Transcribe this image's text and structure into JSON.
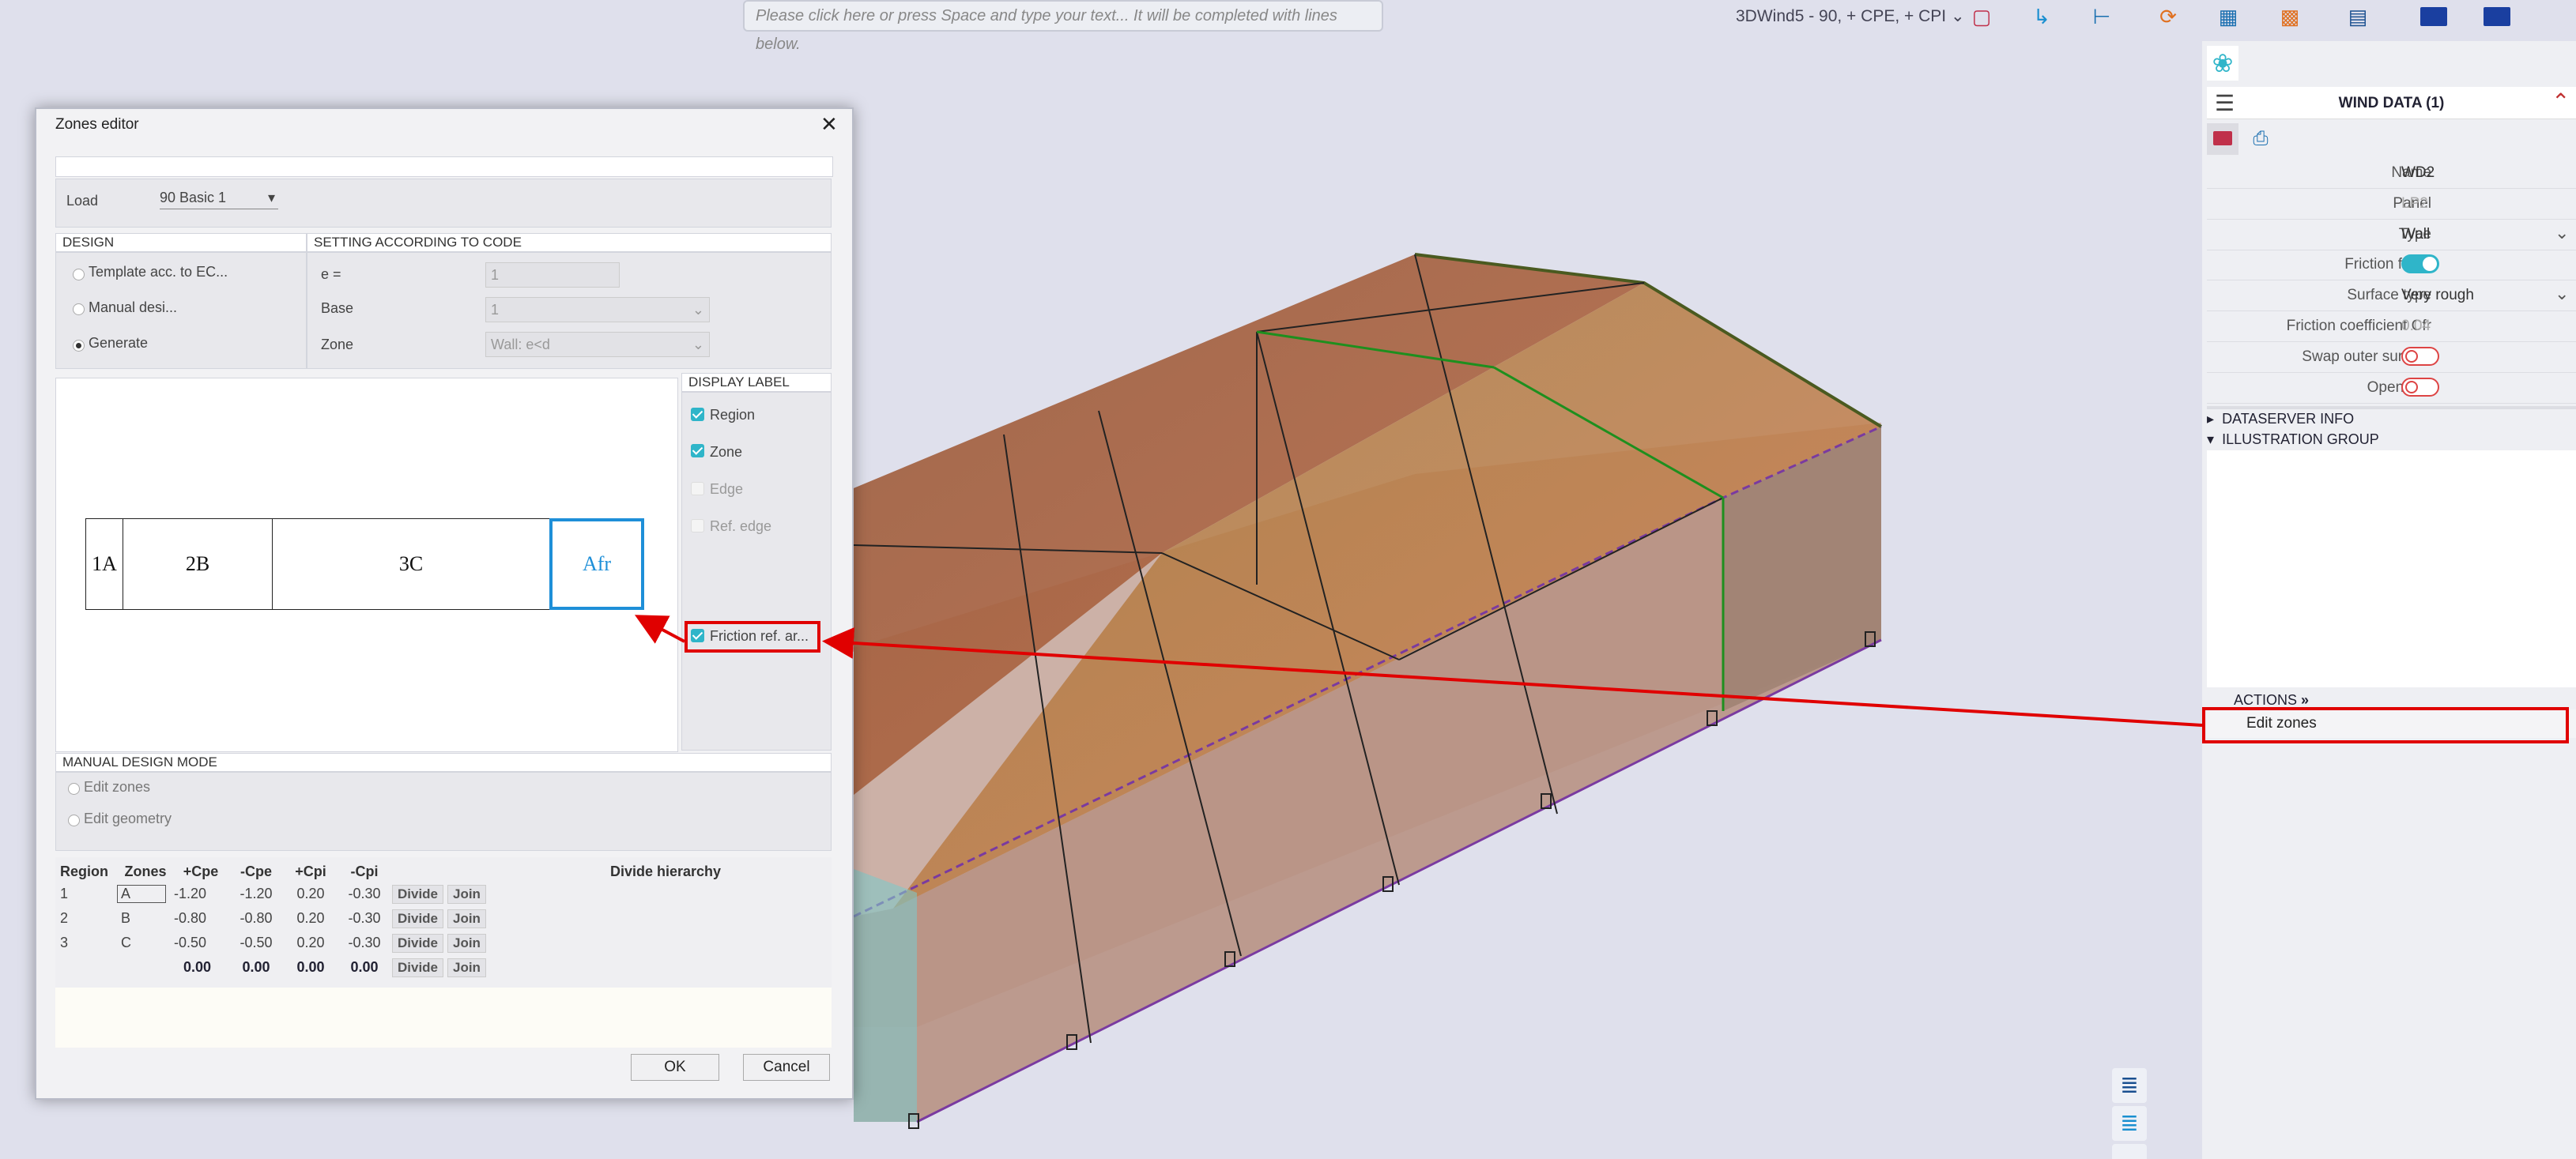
{
  "toolbar": {
    "command_placeholder": "Please click here or press Space and type your text... It will be completed with lines below.",
    "active_load": "3DWind5 - 90, + CPE, + CPI",
    "icons": [
      "view-icon",
      "axis-icon",
      "measure-icon",
      "refresh-icon",
      "structure-icon",
      "lock-icon",
      "layout-icon",
      "eu-flag-icon",
      "eu-flag-icon"
    ]
  },
  "dialog": {
    "title": "Zones editor",
    "load_label": "Load",
    "load_value": "90 Basic 1",
    "design_header": "DESIGN",
    "design_options": [
      "Template acc. to EC...",
      "Manual desi...",
      "Generate"
    ],
    "design_selected": 2,
    "setting_header": "SETTING ACCORDING TO CODE",
    "settings": [
      {
        "label": "e =",
        "value": "1"
      },
      {
        "label": "Base",
        "value": "1"
      },
      {
        "label": "Zone",
        "value": "Wall: e<d"
      }
    ],
    "zones": [
      "1A",
      "2B",
      "3C",
      "Afr"
    ],
    "display_label_header": "DISPLAY LABEL",
    "display_labels": [
      {
        "label": "Region",
        "checked": true
      },
      {
        "label": "Zone",
        "checked": true
      },
      {
        "label": "Edge",
        "checked": false
      },
      {
        "label": "Ref. edge",
        "checked": false
      }
    ],
    "friction_label": "Friction ref. ar...",
    "manual_header": "MANUAL DESIGN MODE",
    "manual_options": [
      "Edit zones",
      "Edit geometry"
    ],
    "table": {
      "columns": [
        "Region",
        "Zones",
        "+Cpe",
        "-Cpe",
        "+Cpi",
        "-Cpi",
        "",
        "",
        "Divide hierarchy"
      ],
      "rows": [
        {
          "region": "1",
          "zone": "A",
          "pcpe": "-1.20",
          "mcpe": "-1.20",
          "pcpi": "0.20",
          "mcpi": "-0.30"
        },
        {
          "region": "2",
          "zone": "B",
          "pcpe": "-0.80",
          "mcpe": "-0.80",
          "pcpi": "0.20",
          "mcpi": "-0.30"
        },
        {
          "region": "3",
          "zone": "C",
          "pcpe": "-0.50",
          "mcpe": "-0.50",
          "pcpi": "0.20",
          "mcpi": "-0.30"
        },
        {
          "region": "",
          "zone": "",
          "pcpe": "0.00",
          "mcpe": "0.00",
          "pcpi": "0.00",
          "mcpi": "0.00"
        }
      ],
      "divide_label": "Divide",
      "join_label": "Join"
    },
    "ok_label": "OK",
    "cancel_label": "Cancel"
  },
  "panel": {
    "title": "WIND DATA (1)",
    "properties": [
      {
        "label": "Name",
        "value": "WD2"
      },
      {
        "label": "Panel",
        "value": "LP2"
      },
      {
        "label": "Type",
        "value": "Wall"
      },
      {
        "label": "Friction force",
        "value": ""
      },
      {
        "label": "Surface type",
        "value": "Very rough"
      },
      {
        "label": "Friction coefficient Cfr",
        "value": "0.04"
      },
      {
        "label": "Swap outer surface",
        "value": ""
      },
      {
        "label": "Openings",
        "value": ""
      }
    ],
    "groups": [
      "DATASERVER INFO",
      "ILLUSTRATION GROUP"
    ],
    "actions_header": "ACTIONS",
    "actions": [
      "Edit zones"
    ]
  },
  "colors": {
    "accent": "#2fb5c9",
    "highlight": "#e00000",
    "zone_selected": "#1e8fd8"
  }
}
